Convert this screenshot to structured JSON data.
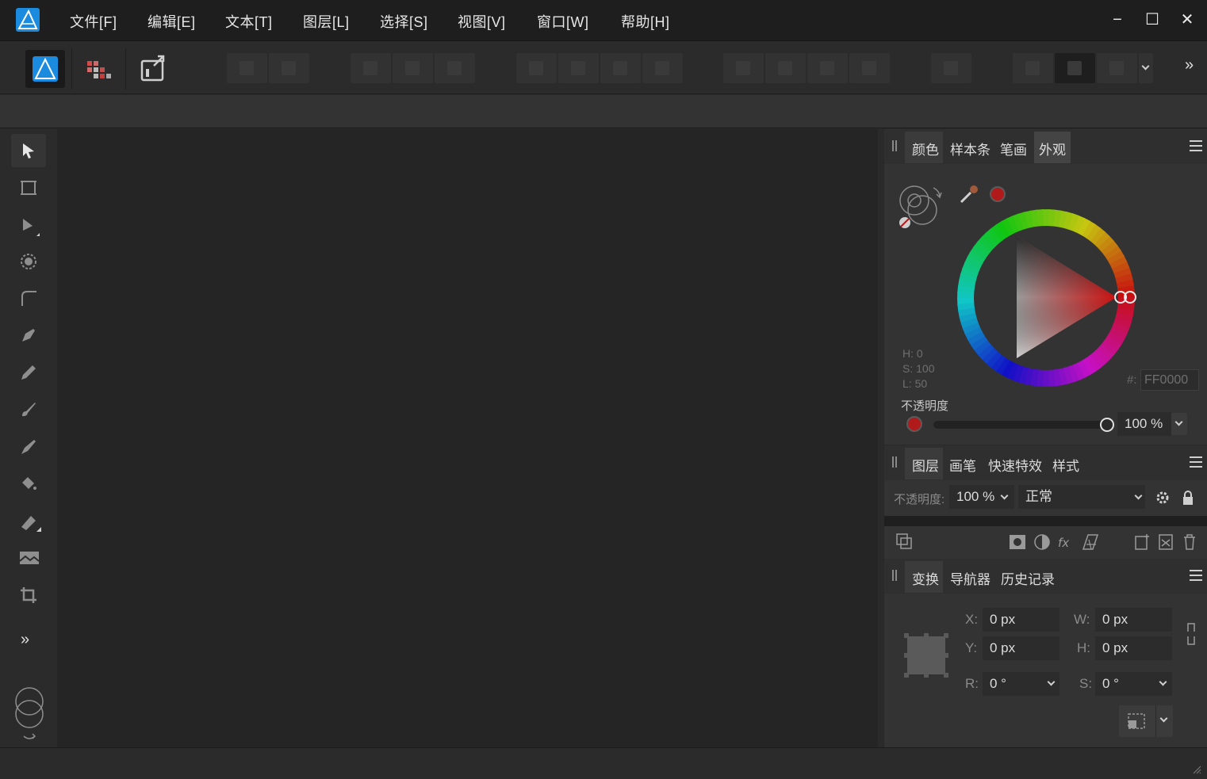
{
  "menu": {
    "items": [
      "文件[F]",
      "编辑[E]",
      "文本[T]",
      "图层[L]",
      "选择[S]",
      "视图[V]",
      "窗口[W]",
      "帮助[H]"
    ]
  },
  "window_controls": {
    "minimize": "−",
    "maximize": "☐",
    "close": "✕"
  },
  "toolbar": {
    "more": "»"
  },
  "tools": {
    "expand": "»"
  },
  "color_panel": {
    "tabs": [
      "颜色",
      "样本条",
      "笔画",
      "外观"
    ],
    "active_tab": "颜色",
    "h": "H: 0",
    "s": "S: 100",
    "l": "L: 50",
    "hex_prefix": "#:",
    "hex": "FF0000",
    "opacity_label": "不透明度",
    "opacity_value": "100 %",
    "opacity_fraction": 1.0,
    "current_color": "#b11a1a"
  },
  "layers_panel": {
    "tabs": [
      "图层",
      "画笔",
      "快速特效",
      "样式"
    ],
    "active_tab": "图层",
    "opacity_label": "不透明度:",
    "opacity_value": "100 %",
    "blend_mode": "正常"
  },
  "transform_panel": {
    "tabs": [
      "变换",
      "导航器",
      "历史记录"
    ],
    "active_tab": "变换",
    "x_label": "X:",
    "x_value": "0 px",
    "y_label": "Y:",
    "y_value": "0 px",
    "w_label": "W:",
    "w_value": "0 px",
    "h_label": "H:",
    "h_value": "0 px",
    "r_label": "R:",
    "r_value": "0 °",
    "s_label": "S:",
    "s_value": "0 °"
  }
}
